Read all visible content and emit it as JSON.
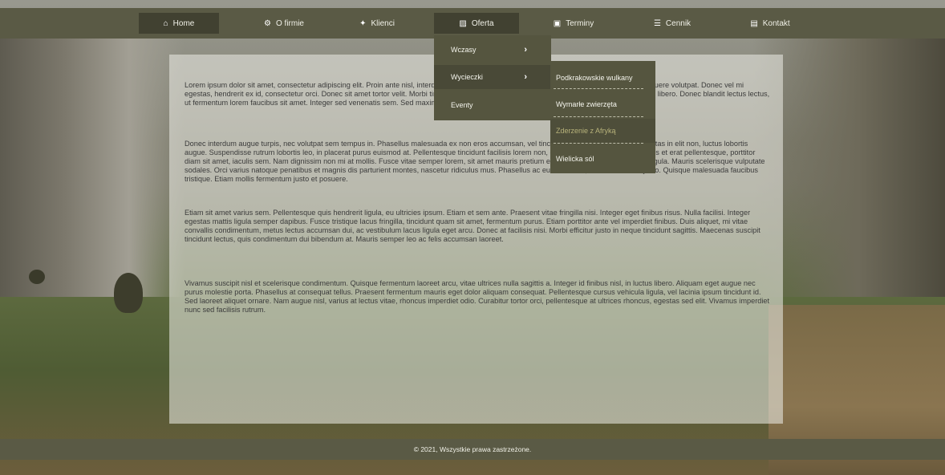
{
  "nav": {
    "items": [
      {
        "label": "Home",
        "icon": "home-icon",
        "glyph": "⌂"
      },
      {
        "label": "O firmie",
        "icon": "cogs-icon",
        "glyph": "⚙"
      },
      {
        "label": "Klienci",
        "icon": "handshake-icon",
        "glyph": "✦"
      },
      {
        "label": "Oferta",
        "icon": "map-icon",
        "glyph": "▨"
      },
      {
        "label": "Terminy",
        "icon": "calendar-icon",
        "glyph": "▣"
      },
      {
        "label": "Cennik",
        "icon": "money-icon",
        "glyph": "☰"
      },
      {
        "label": "Kontakt",
        "icon": "address-card-icon",
        "glyph": "▤"
      }
    ]
  },
  "oferta_menu": {
    "items": [
      {
        "label": "Wczasy",
        "chevron": "›"
      },
      {
        "label": "Wycieczki",
        "chevron": "›"
      },
      {
        "label": "Eventy",
        "chevron": ""
      }
    ]
  },
  "wycieczki_menu": {
    "items": [
      {
        "label": "Podkrakowskie wulkany"
      },
      {
        "label": "Wymarłe zwierzęta"
      },
      {
        "label": "Zderzenie z Afryką"
      },
      {
        "label": "Wielicka sól"
      }
    ]
  },
  "content": {
    "paragraphs": [
      "Lorem ipsum dolor sit amet, consectetur adipiscing elit. Proin ante nisl, interdum ut rhoncus et, tincidunt quis risus. Suspendisse scelerisque posuere volutpat. Donec vel mi egestas, hendrerit ex id, consectetur orci. Donec sit amet tortor velit. Morbi tincidunt vehicula nisl id mi. Fusce a maximus velit. In non fermentum libero. Donec blandit lectus lectus, ut fermentum lorem faucibus sit amet. Integer sed venenatis sem. Sed maximus eget sit amet augue.",
      "Donec interdum augue turpis, nec volutpat sem tempus in. Phasellus malesuada ex non eros accumsan, vel tincidunt mi dictum. Sed nunc, egestas in elit non, luctus lobortis augue. Suspendisse rutrum lobortis leo, in placerat purus euismod at. Pellentesque tincidunt facilisis lorem non, convallis bibendum purus. Mauris et erat pellentesque, porttitor diam sit amet, iaculis sem. Nam dignissim non mi at mollis. Fusce vitae semper lorem, sit amet mauris pretium eleifend. Quisque a elementum ligula. Mauris scelerisque vulputate sodales. Orci varius natoque penatibus et magnis dis parturient montes, nascetur ridiculus mus. Phasellus ac euismod felis, sed consectetur justo. Quisque malesuada faucibus tristique. Etiam mollis fermentum justo et posuere.",
      "Etiam sit amet varius sem. Pellentesque quis hendrerit ligula, eu ultricies ipsum. Etiam et sem ante. Praesent vitae fringilla nisi. Integer eget finibus risus. Nulla facilisi. Integer egestas mattis ligula semper dapibus. Fusce tristique lacus fringilla, tincidunt quam sit amet, fermentum purus. Etiam porttitor ante vel imperdiet finibus. Duis aliquet, mi vitae convallis condimentum, metus lectus accumsan dui, ac vestibulum lacus ligula eget arcu. Donec at facilisis nisi. Morbi efficitur justo in neque tincidunt sagittis. Maecenas suscipit tincidunt lectus, quis condimentum dui bibendum at. Mauris semper leo ac felis accumsan laoreet.",
      "Vivamus suscipit nisl et scelerisque condimentum. Quisque fermentum laoreet arcu, vitae ultrices nulla sagittis a. Integer id finibus nisl, in luctus libero. Aliquam eget augue nec purus molestie porta. Phasellus at consequat tellus. Praesent fermentum mauris eget dolor aliquam consequat. Pellentesque cursus vehicula ligula, vel lacinia ipsum tincidunt id. Sed laoreet aliquet ornare. Nam augue nisl, varius at lectus vitae, rhoncus imperdiet odio. Curabitur tortor orci, pellentesque at ultrices rhoncus, egestas sed elit. Vivamus imperdiet nunc sed facilisis rutrum."
    ]
  },
  "footer": {
    "text": "© 2021, Wszystkie prawa zastrzeżone."
  },
  "colors": {
    "nav_bg": "#5a5a45",
    "nav_active": "#414131",
    "dropdown_bg": "#55553f",
    "submenu_current": "#b7b27a"
  }
}
